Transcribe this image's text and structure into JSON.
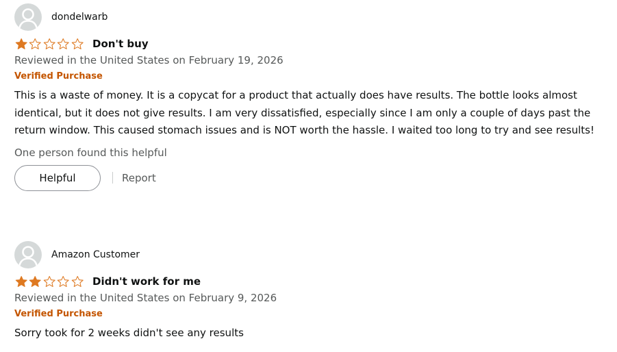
{
  "reviews": [
    {
      "reviewer": "dondelwarb",
      "rating": 1,
      "max_rating": 5,
      "title": "Don't buy",
      "date_line": "Reviewed in the United States on February 19, 2026",
      "badge": "Verified Purchase",
      "body": "This is a waste of money. It is a copycat for a product that actually does have results. The bottle looks almost identical, but it does not give results. I am very dissatisfied, especially since I am only a couple of days past the return window. This caused stomach issues and is NOT worth the hassle. I waited too long to try and see results!",
      "helpful_text": "One person found this helpful",
      "helpful_label": "Helpful",
      "report_label": "Report"
    },
    {
      "reviewer": "Amazon Customer",
      "rating": 2,
      "max_rating": 5,
      "title": "Didn't work for me",
      "date_line": "Reviewed in the United States on February 9, 2026",
      "badge": "Verified Purchase",
      "body": "Sorry took for 2 weeks didn't see any results"
    }
  ],
  "colors": {
    "star_fill": "#de7921",
    "verified": "#c45500",
    "secondary_text": "#565959",
    "avatar_bg": "#d5d9d9"
  },
  "icons": {
    "avatar": "default-avatar-icon",
    "star_filled": "star-filled-icon",
    "star_empty": "star-empty-icon"
  }
}
